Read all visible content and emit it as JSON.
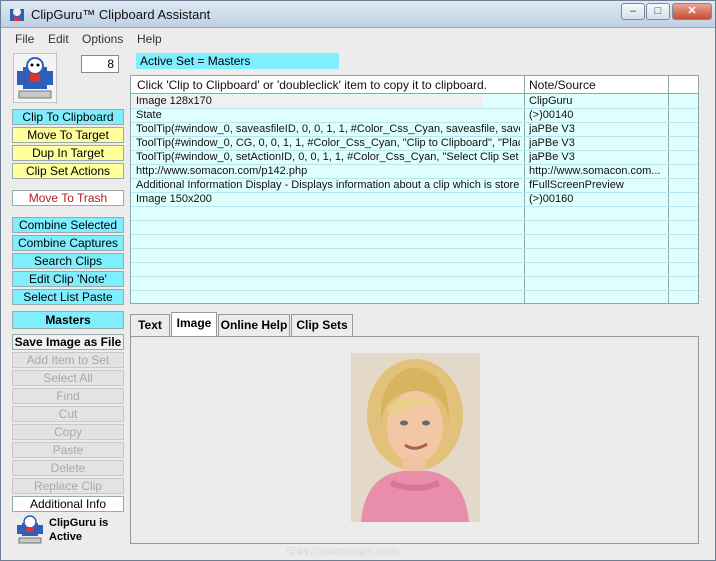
{
  "window": {
    "title": "ClipGuru™ Clipboard Assistant",
    "minimize": "–",
    "maximize": "□",
    "close": "✕"
  },
  "menu": [
    "File",
    "Edit",
    "Options",
    "Help"
  ],
  "counter": "8",
  "active_set": "Active Set = Masters",
  "sidebar": {
    "buttons": [
      "Clip To Clipboard",
      "Move To Target",
      "Dup In Target",
      "Clip Set Actions",
      "Move To Trash",
      "Combine Selected",
      "Combine Captures",
      "Search Clips",
      "Edit Clip 'Note'",
      "Select List Paste"
    ],
    "masters": "Masters",
    "save_image": "Save Image as File",
    "disabled": [
      "Add Item to Set",
      "Select All",
      "Find",
      "Cut",
      "Copy",
      "Paste",
      "Delete",
      "Replace Clip"
    ],
    "additional_info": "Additional Info"
  },
  "table": {
    "headers": [
      "Click 'Clip to Clipboard' or 'doubleclick' item to copy it to clipboard.",
      "Note/Source"
    ],
    "rows": [
      [
        "Image 128x170",
        "ClipGuru"
      ],
      [
        "State",
        "(>)00140"
      ],
      [
        "ToolTip(#window_0, saveasfileID, 0, 0, 1, 1, #Color_Css_Cyan, saveasfile, savea",
        "jaPBe V3"
      ],
      [
        "ToolTip(#window_0, CG, 0, 0, 1, 1, #Color_Css_Cyan, \"Clip to Clipboard\", \"Place",
        "jaPBe V3"
      ],
      [
        "ToolTip(#window_0, setActionID, 0, 0, 1, 1, #Color_Css_Cyan, \"Select Clip Set",
        "jaPBe V3"
      ],
      [
        "http://www.somacon.com/p142.php",
        "http://www.somacon.com..."
      ],
      [
        "Additional Information Display - Displays information about a clip which is store",
        "fFullScreenPreview"
      ],
      [
        "Image 150x200",
        "(>)00160"
      ]
    ]
  },
  "tabs": [
    "Text",
    "Image",
    "Online Help",
    "Clip Sets"
  ],
  "status": {
    "line1": "ClipGuru is",
    "line2": "Active"
  },
  "watermark": "GearDownload.com",
  "colors": {
    "cyan": "#7fefff",
    "yellow": "#ffff9c",
    "table_bg": "#dfffff",
    "trash_text": "#b02020"
  }
}
